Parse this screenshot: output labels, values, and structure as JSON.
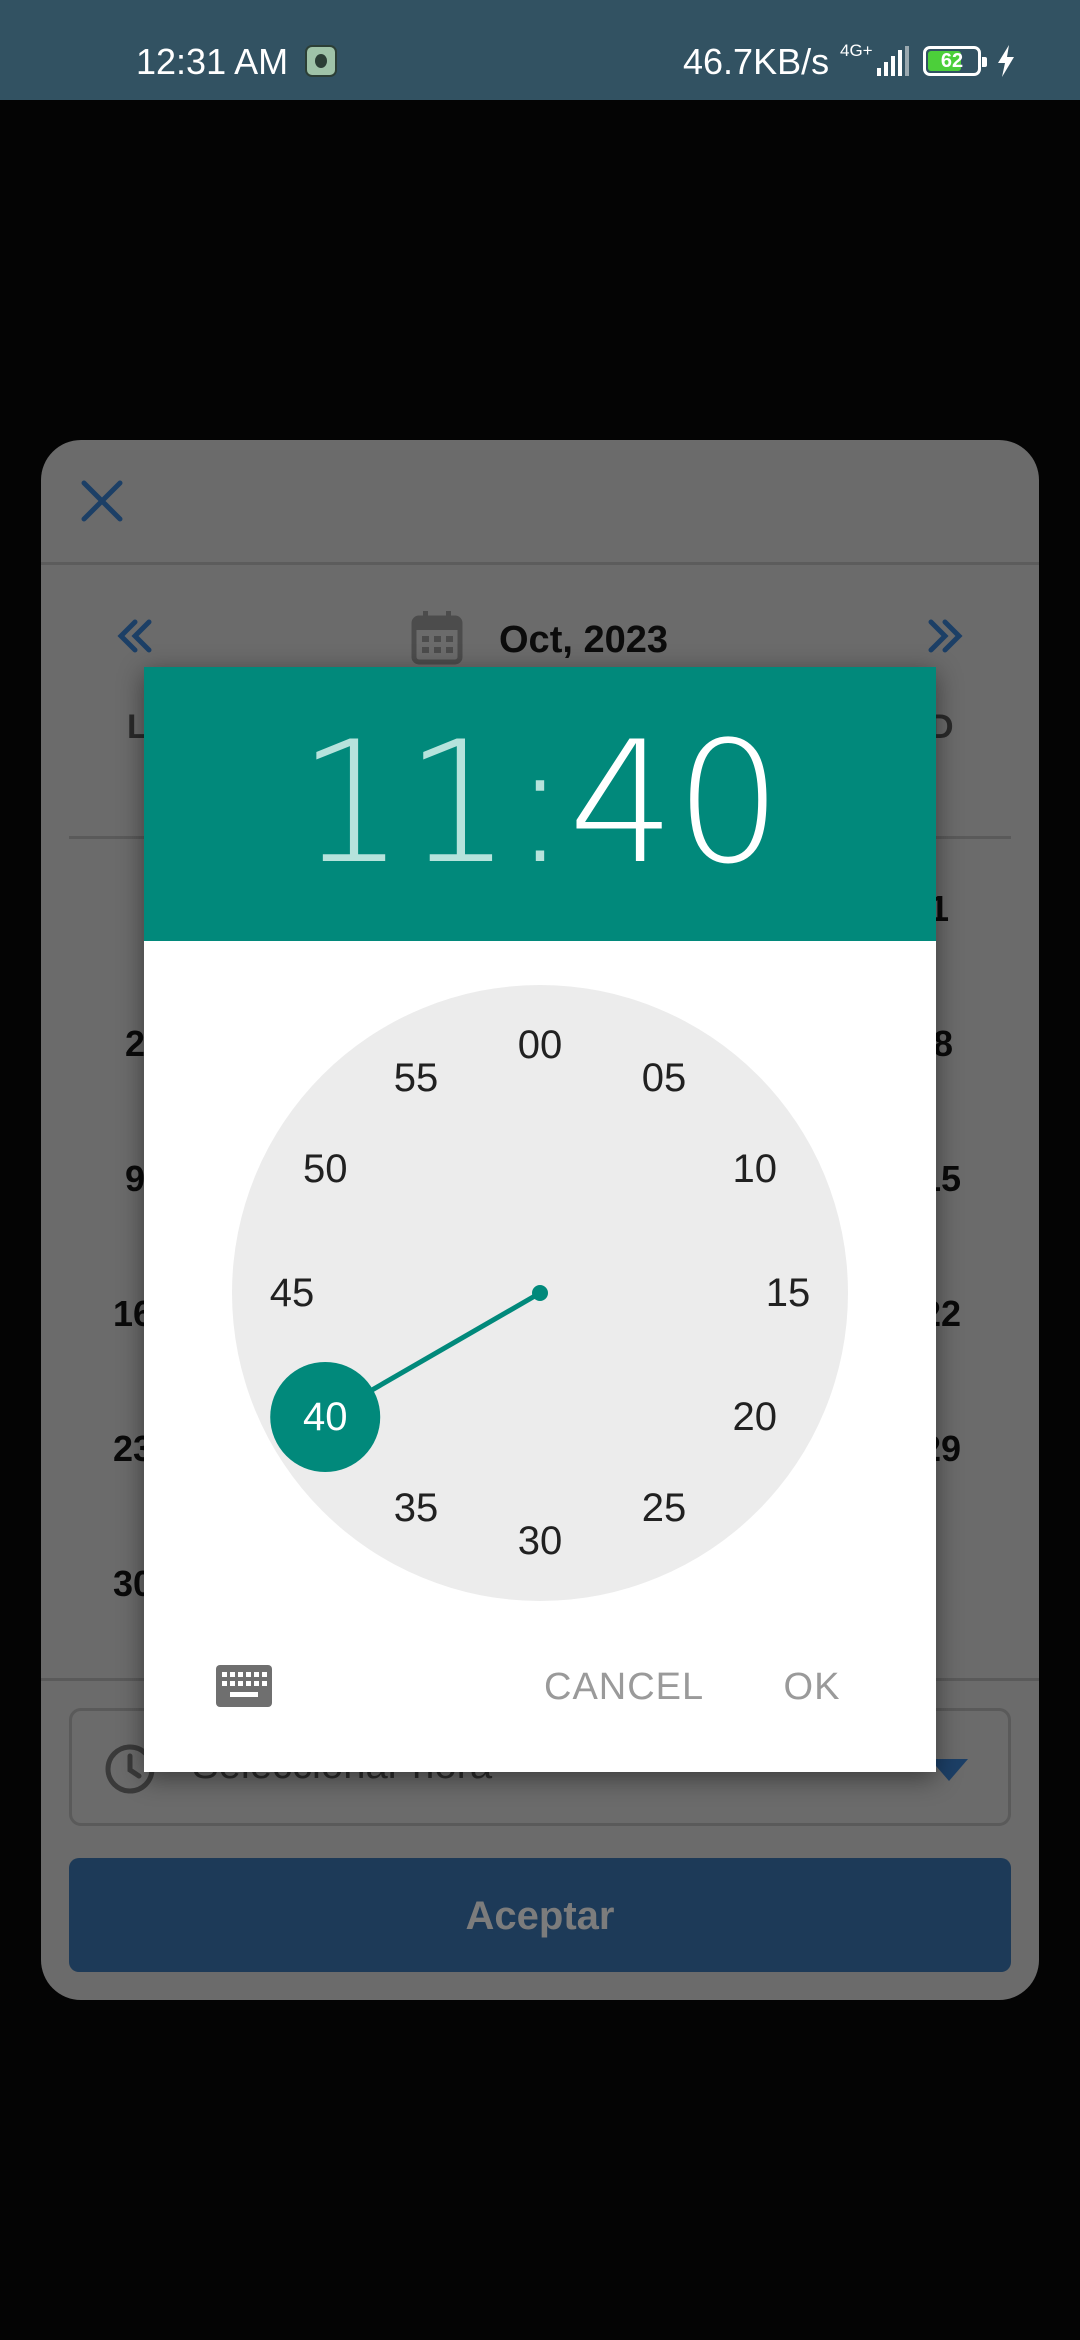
{
  "status_bar": {
    "time": "12:31 AM",
    "net_speed": "46.7KB/s",
    "network_type": "4G+",
    "battery_level": "62",
    "battery_color": "#4ccf3a"
  },
  "calendar": {
    "title": "Oct, 2023",
    "weekday_first": "L",
    "weekday_last": "D",
    "visible_days": [
      "1",
      "2",
      "8",
      "9",
      "15",
      "16",
      "22",
      "23",
      "29",
      "30"
    ],
    "time_placeholder": "Seleccionar hora",
    "accept_label": "Aceptar"
  },
  "time_picker": {
    "hour": "11",
    "separator": ":",
    "minute": "40",
    "accent_color": "#01897b",
    "minute_labels": [
      "00",
      "05",
      "10",
      "15",
      "20",
      "25",
      "30",
      "35",
      "40",
      "45",
      "50",
      "55"
    ],
    "selected_minute": 40,
    "cancel_label": "CANCEL",
    "ok_label": "OK"
  }
}
